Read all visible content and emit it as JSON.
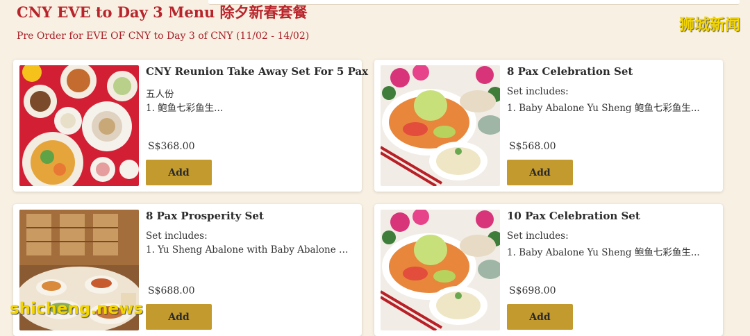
{
  "page": {
    "title": "CNY EVE to Day 3 Menu 除夕新春套餐",
    "subtitle": "Pre Order for EVE OF CNY to Day 3 of CNY (11/02 - 14/02)"
  },
  "watermarks": {
    "top": "狮城新闻",
    "bottom": "shicheng.news"
  },
  "colors": {
    "background": "#f8f0e2",
    "title": "#b8242c",
    "add_button": "#c39a2e"
  },
  "products": [
    {
      "name": "CNY Reunion Take Away Set For 5 Pax",
      "desc_line1": "五人份",
      "desc_line2": "1. 鲍鱼七彩鱼生...",
      "price": "S$368.00",
      "add_label": "Add",
      "image": "cny-feast-red-tablecloth-image"
    },
    {
      "name": "8 Pax Celebration Set",
      "desc_line1": "Set includes:",
      "desc_line2": "1. Baby Abalone Yu Sheng 鲍鱼七彩鱼生...",
      "price": "S$568.00",
      "add_label": "Add",
      "image": "yu-sheng-platter-image"
    },
    {
      "name": "8 Pax Prosperity Set",
      "desc_line1": "Set includes:",
      "desc_line2": "1. Yu Sheng Abalone with Baby Abalone & ...",
      "price": "S$688.00",
      "add_label": "Add",
      "image": "banquet-table-image"
    },
    {
      "name": "10 Pax Celebration Set",
      "desc_line1": "Set includes:",
      "desc_line2": "1. Baby Abalone Yu Sheng 鲍鱼七彩鱼生...",
      "price": "S$698.00",
      "add_label": "Add",
      "image": "yu-sheng-platter-image"
    }
  ]
}
